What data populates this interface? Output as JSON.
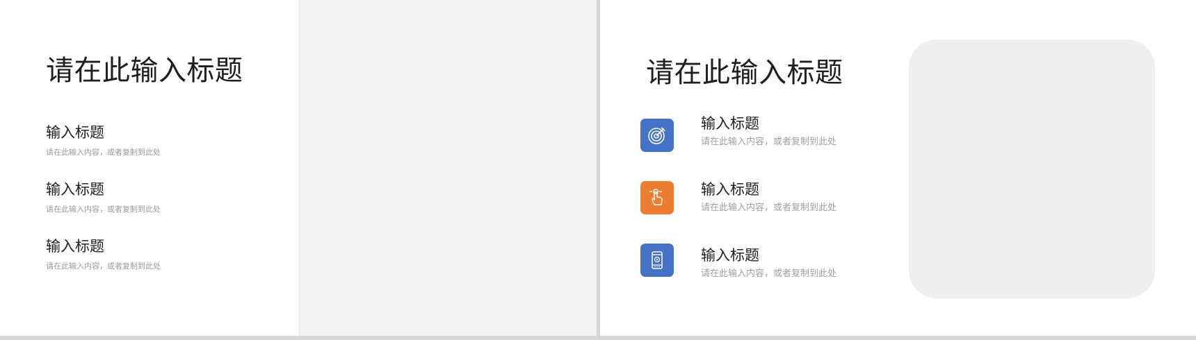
{
  "slides": [
    {
      "title": "请在此输入标题",
      "items": [
        {
          "heading": "输入标题",
          "desc": "请在此输入内容，或者复制到此处"
        },
        {
          "heading": "输入标题",
          "desc": "请在此输入内容，或者复制到此处"
        },
        {
          "heading": "输入标题",
          "desc": "请在此输入内容，或者复制到此处"
        }
      ]
    },
    {
      "title": "请在此输入标题",
      "items": [
        {
          "heading": "输入标题",
          "desc": "请在此输入内容，或者复制到此处",
          "icon": "target-icon",
          "color": "#4472c4"
        },
        {
          "heading": "输入标题",
          "desc": "请在此输入内容，或者复制到此处",
          "icon": "hand-pointer-icon",
          "color": "#ed7d31"
        },
        {
          "heading": "输入标题",
          "desc": "请在此输入内容，或者复制到此处",
          "icon": "phone-icon",
          "color": "#4472c4"
        }
      ]
    }
  ]
}
